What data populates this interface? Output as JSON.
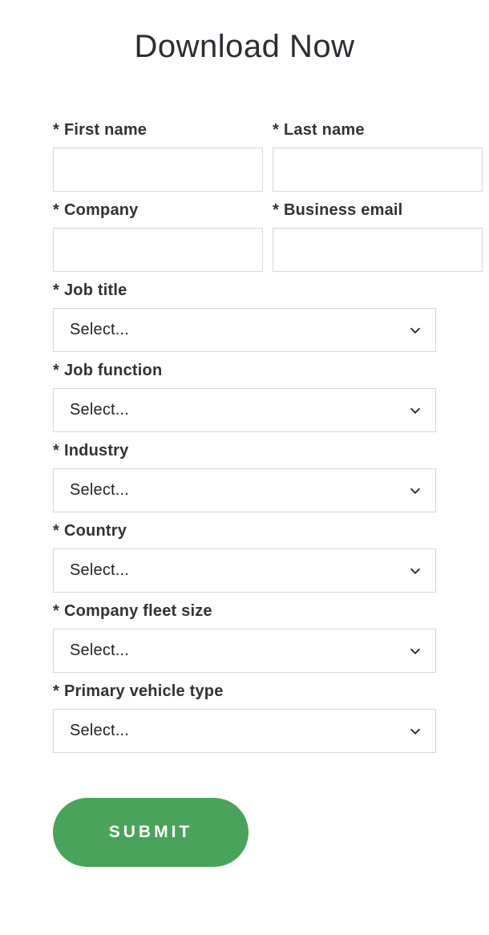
{
  "title": "Download Now",
  "required_marker": "*",
  "fields": {
    "first_name": {
      "label": "First name",
      "value": ""
    },
    "last_name": {
      "label": "Last name",
      "value": ""
    },
    "company": {
      "label": "Company",
      "value": ""
    },
    "business_email": {
      "label": "Business email",
      "value": ""
    },
    "job_title": {
      "label": "Job title",
      "placeholder": "Select..."
    },
    "job_function": {
      "label": "Job function",
      "placeholder": "Select..."
    },
    "industry": {
      "label": "Industry",
      "placeholder": "Select..."
    },
    "country": {
      "label": "Country",
      "placeholder": "Select..."
    },
    "company_fleet_size": {
      "label": "Company fleet size",
      "placeholder": "Select..."
    },
    "primary_vehicle_type": {
      "label": "Primary vehicle type",
      "placeholder": "Select..."
    }
  },
  "submit_label": "SUBMIT"
}
